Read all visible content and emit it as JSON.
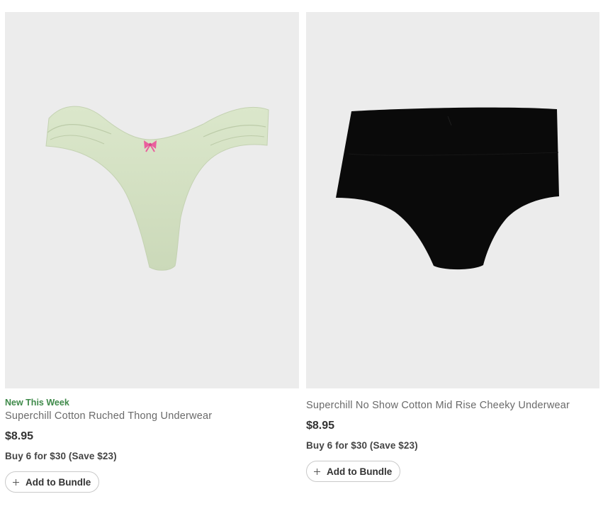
{
  "products": [
    {
      "badge": "New This Week",
      "name": "Superchill Cotton Ruched Thong Underwear",
      "price": "$8.95",
      "promo": "Buy 6 for $30 (Save $23)",
      "button_label": "Add to Bundle",
      "color": "#d6e3c6",
      "accent": "#ea5f9d"
    },
    {
      "name": "Superchill No Show Cotton Mid Rise Cheeky Underwear",
      "price": "$8.95",
      "promo": "Buy 6 for $30 (Save $23)",
      "button_label": "Add to Bundle",
      "color": "#0a0a0a"
    }
  ]
}
